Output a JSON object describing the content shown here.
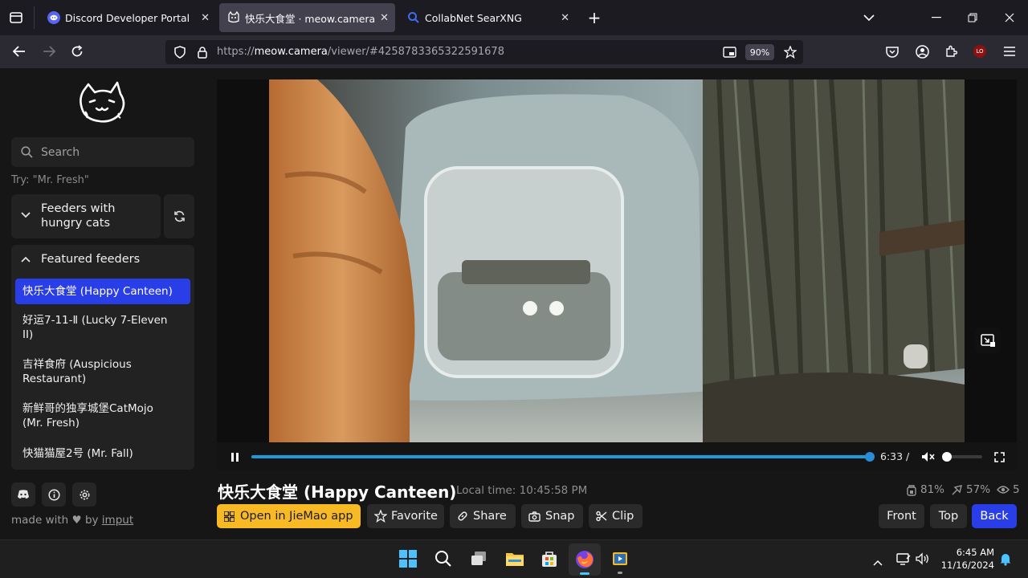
{
  "tabs": [
    {
      "label": "Discord Developer Portal",
      "icon": "discord-icon"
    },
    {
      "label": "快乐大食堂 · meow.camera",
      "icon": "cat-icon"
    },
    {
      "label": "CollabNet SearXNG",
      "icon": "search-icon"
    }
  ],
  "url": {
    "prefix": "https://",
    "domain": "meow.camera",
    "path": "/viewer/#4258783365322591678"
  },
  "zoom": "90%",
  "ext_badge": "LO",
  "search": {
    "placeholder": "Search",
    "hint": "Try: \"Mr. Fresh\""
  },
  "hungry": {
    "label_line1": "Feeders with",
    "label_line2": "hungry cats"
  },
  "featured": {
    "label": "Featured feeders"
  },
  "feeders": [
    {
      "line1": "快乐大食堂 (Happy Canteen)",
      "line2": ""
    },
    {
      "line1": "好运7-11-Ⅱ (Lucky 7-Eleven",
      "line2": "II)"
    },
    {
      "line1": "吉祥食府 (Auspicious",
      "line2": "Restaurant)"
    },
    {
      "line1": "新鲜哥的独享城堡CatMojo",
      "line2": "(Mr. Fresh)"
    },
    {
      "line1": "快猫猫屋2号 (Mr. Fall)",
      "line2": ""
    }
  ],
  "footer": {
    "made_with": "made with",
    "by": "by",
    "author": "imput"
  },
  "player": {
    "time": "6:33 /",
    "progress": 1.0,
    "volume": 0.0
  },
  "feeder_title": "快乐大食堂 (Happy Canteen)",
  "local_time": "Local time: 10:45:58 PM",
  "stats": {
    "food": "81%",
    "battery": "57%",
    "viewers": "5"
  },
  "actions": {
    "open_app": "Open in JieMao app",
    "favorite": "Favorite",
    "share": "Share",
    "snap": "Snap",
    "clip": "Clip"
  },
  "views": {
    "front": "Front",
    "top": "Top",
    "back": "Back"
  },
  "clock": {
    "time": "6:45 AM",
    "date": "11/16/2024"
  },
  "colors": {
    "accent": "#2a3ee8",
    "progress": "#1e9ad6",
    "yellow": "#f7b924"
  }
}
